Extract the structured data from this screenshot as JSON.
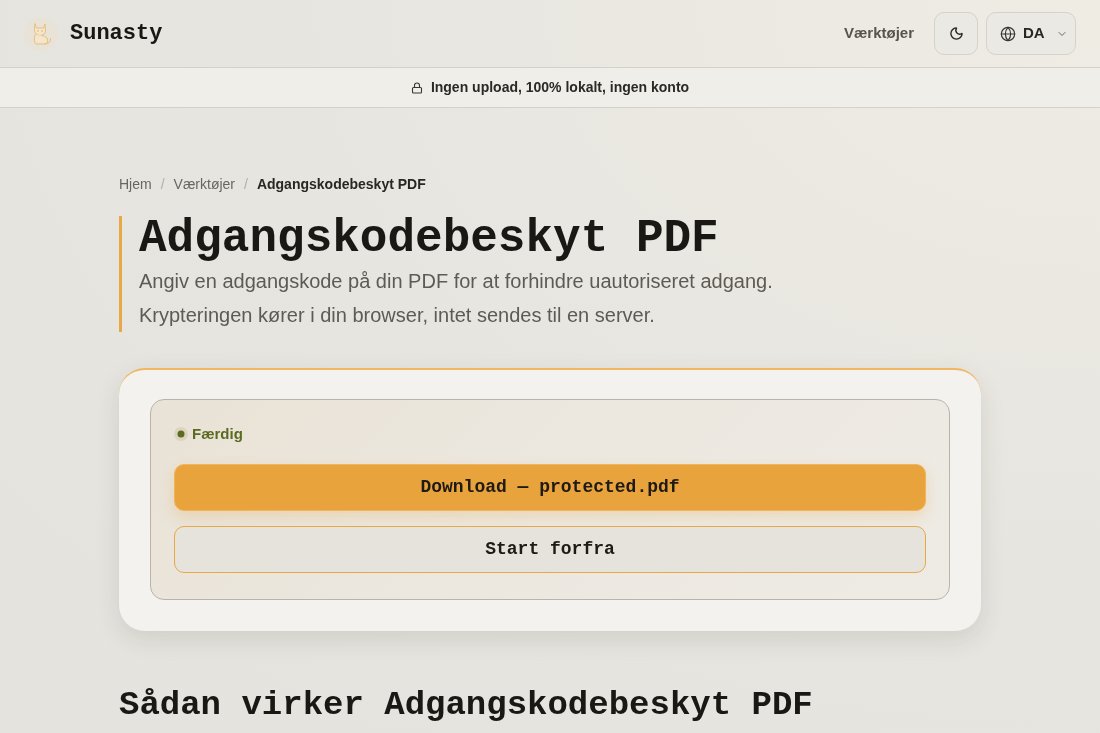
{
  "header": {
    "logo": "Sunasty",
    "nav_link": "Værktøjer",
    "language": "DA"
  },
  "banner": "Ingen upload, 100% lokalt, ingen konto",
  "breadcrumb": [
    {
      "label": "Hjem",
      "current": false
    },
    {
      "separator": "/",
      "label": "Værktøjer",
      "current": false
    },
    {
      "separator": "/",
      "label": "Adgangskodebeskyt PDF",
      "current": true
    }
  ],
  "page": {
    "title": "Adgangskodebeskyt PDF",
    "description": "Angiv en adgangskode på din PDF for at forhindre uautoriseret adgang. Krypteringen kører i din browser, intet sendes til en server."
  },
  "result": {
    "status": {
      "kind": "done",
      "label": "Færdig"
    },
    "actions": [
      {
        "kind": "primary",
        "label": "Download — protected.pdf"
      },
      {
        "kind": "secondary",
        "label": "Start forfra"
      }
    ]
  },
  "section_heading": "Sådan virker Adgangskodebeskyt PDF"
}
